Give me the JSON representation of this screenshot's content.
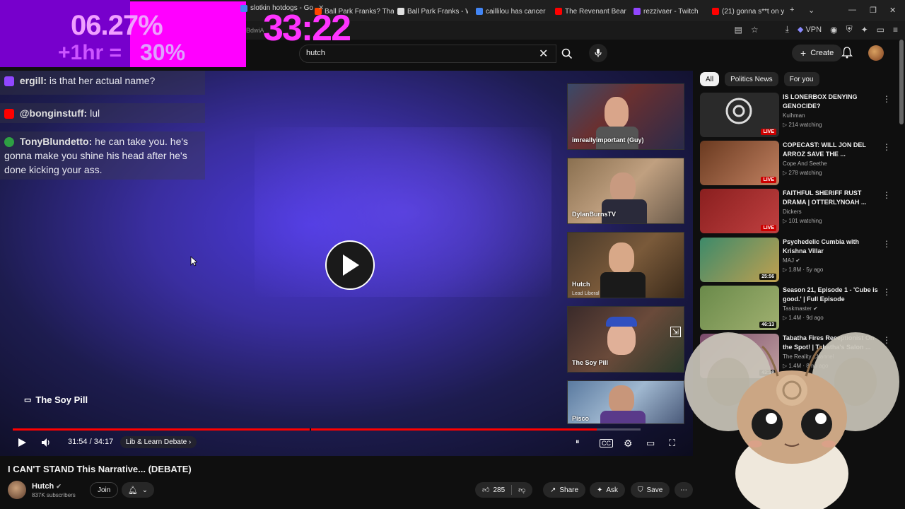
{
  "browser": {
    "tabs": [
      {
        "label": "slotkin hotdogs - Go",
        "color": "#4285f4"
      },
      {
        "label": "Ball Park Franks? Thank",
        "color": "#ff4500"
      },
      {
        "label": "Ball Park Franks - Wi",
        "color": "#e0e0e0"
      },
      {
        "label": "caillilou has cancer",
        "color": "#4285f4"
      },
      {
        "label": "The Revenant Bear A",
        "color": "#ff0000"
      },
      {
        "label": "rezzivaer - Twitch",
        "color": "#9146ff"
      },
      {
        "label": "(21) gonna s**t on y",
        "color": "#ff0000"
      }
    ],
    "url_fragment": "BdwiA",
    "vpn_label": "VPN"
  },
  "overlay": {
    "percent_top": "06.27%",
    "bonus_text": "+1hr =",
    "percent_bottom": "30%",
    "timer": "33:22"
  },
  "header": {
    "search_value": "hutch",
    "create_label": "Create"
  },
  "chat": [
    {
      "user": "ergill:",
      "text": " is that her actual name?",
      "badge_color": "#9146ff"
    },
    {
      "user": "@bonginstuff:",
      "text": " lul",
      "badge_color": "#ff0000"
    },
    {
      "user": "TonyBlundetto:",
      "text": " he can take you. he's gonna make you shine his head after he's done kicking your ass.",
      "badge_color": "#2ea043"
    }
  ],
  "player": {
    "channel_overlay": "The Soy Pill",
    "time": "31:54 / 34:17",
    "chapter": "Lib & Learn Debate",
    "progress": 0.93
  },
  "tiles": [
    {
      "label": "imreallyimportant (Guy)",
      "sub": ""
    },
    {
      "label": "DylanBurnsTV",
      "sub": ""
    },
    {
      "label": "Hutch",
      "sub": "Lead Liberal"
    },
    {
      "label": "The Soy Pill",
      "sub": ""
    },
    {
      "label": "Pisco",
      "sub": ""
    }
  ],
  "video": {
    "title": "I CAN'T STAND This Narrative... (DEBATE)",
    "channel": "Hutch",
    "subscribers": "837K subscribers",
    "join_label": "Join",
    "likes": "285",
    "share_label": "Share",
    "ask_label": "Ask",
    "save_label": "Save"
  },
  "chips": [
    "All",
    "Politics News",
    "For you"
  ],
  "recommendations": [
    {
      "title": "IS LONERBOX DENYING GENOCIDE?",
      "channel": "Kuihman",
      "meta": "214 watching",
      "badge": "LIVE",
      "thumb": "#2a2a2a"
    },
    {
      "title": "COPECAST: WILL JON DEL ARROZ SAVE THE ...",
      "channel": "Cope And Seethe",
      "meta": "278 watching",
      "badge": "LIVE",
      "thumb": "#5a3020"
    },
    {
      "title": "FAITHFUL SHERIFF RUST DRAMA | OTTERLYNOAH ...",
      "channel": "Dickers",
      "meta": "101 watching",
      "badge": "LIVE",
      "thumb": "#8a1f1f"
    },
    {
      "title": "Psychedelic Cumbia with Krishna Villar",
      "channel": "MAJ",
      "meta": "1.8M · 5y ago",
      "badge": "25:56",
      "thumb": "#3c8a6a"
    },
    {
      "title": "Season 21, Episode 1 - 'Cube is good.' | Full Episode",
      "channel": "Taskmaster",
      "meta": "1.4M · 9d ago",
      "badge": "46:13",
      "thumb": "#6a8a4a"
    },
    {
      "title": "Tabatha Fires Receptionist On the Spot! | Tabatha's Salon ...",
      "channel": "The Reality Channel",
      "meta": "1.4M · 8mo ago",
      "badge": "43:18",
      "thumb": "#7a4a6a"
    }
  ]
}
